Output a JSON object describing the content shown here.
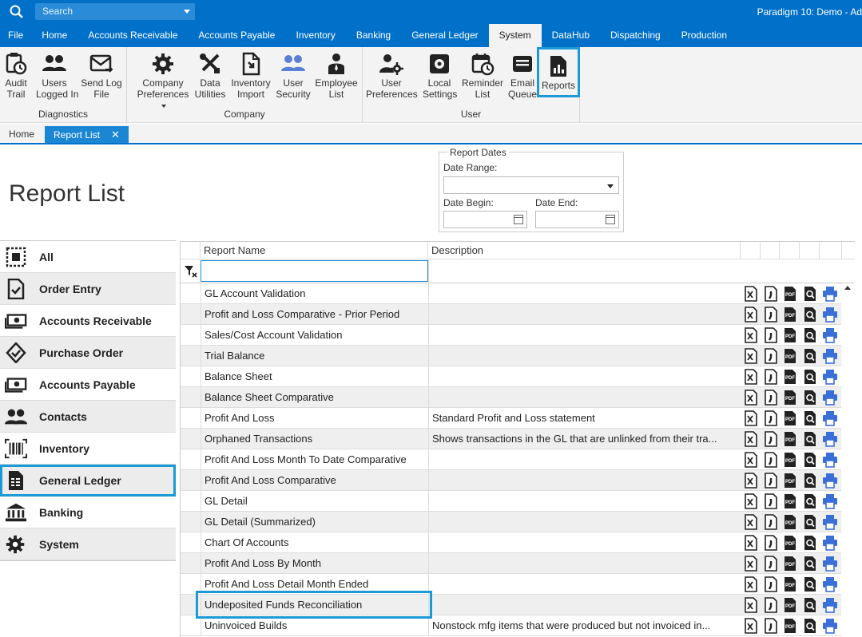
{
  "search": {
    "placeholder": "Search"
  },
  "app_title": "Paradigm 10: Demo - Ad",
  "menu": [
    "File",
    "Home",
    "Accounts Receivable",
    "Accounts Payable",
    "Inventory",
    "Banking",
    "General Ledger",
    "System",
    "DataHub",
    "Dispatching",
    "Production"
  ],
  "menu_active": "System",
  "ribbon": {
    "diagnostics": {
      "label": "Diagnostics",
      "buttons": [
        "Audit\nTrail",
        "Users\nLogged In",
        "Send Log\nFile"
      ]
    },
    "company": {
      "label": "Company",
      "buttons": [
        "Company\nPreferences",
        "Data\nUtilities",
        "Inventory\nImport",
        "User\nSecurity",
        "Employee\nList"
      ]
    },
    "user": {
      "label": "User",
      "buttons": [
        "User\nPreferences",
        "Local\nSettings",
        "Reminder\nList",
        "Email\nQueue",
        "Reports"
      ]
    }
  },
  "tabs": [
    "Home",
    "Report List"
  ],
  "tab_close": "✕",
  "page_title": "Report List",
  "report_dates": {
    "legend": "Report Dates",
    "date_range": "Date Range:",
    "date_begin": "Date Begin:",
    "date_end": "Date End:"
  },
  "sidebar": [
    "All",
    "Order Entry",
    "Accounts Receivable",
    "Purchase Order",
    "Accounts Payable",
    "Contacts",
    "Inventory",
    "General Ledger",
    "Banking",
    "System"
  ],
  "sidebar_selected": "General Ledger",
  "grid": {
    "columns": [
      "Report Name",
      "Description"
    ],
    "rows": [
      {
        "name": "GL Account Validation",
        "desc": ""
      },
      {
        "name": "Profit and Loss Comparative - Prior Period",
        "desc": ""
      },
      {
        "name": "Sales/Cost Account Validation",
        "desc": ""
      },
      {
        "name": "Trial Balance",
        "desc": ""
      },
      {
        "name": "Balance Sheet",
        "desc": ""
      },
      {
        "name": "Balance Sheet Comparative",
        "desc": ""
      },
      {
        "name": "Profit And Loss",
        "desc": "Standard Profit and Loss statement"
      },
      {
        "name": "Orphaned Transactions",
        "desc": "Shows transactions in the GL that are unlinked from their tra..."
      },
      {
        "name": "Profit And Loss Month To Date Comparative",
        "desc": ""
      },
      {
        "name": "Profit And Loss Comparative",
        "desc": ""
      },
      {
        "name": "GL Detail",
        "desc": ""
      },
      {
        "name": "GL Detail (Summarized)",
        "desc": ""
      },
      {
        "name": "Chart Of Accounts",
        "desc": ""
      },
      {
        "name": "Profit And Loss By Month",
        "desc": ""
      },
      {
        "name": "Profit And Loss Detail Month Ended",
        "desc": ""
      },
      {
        "name": "Undeposited Funds Reconciliation",
        "desc": ""
      },
      {
        "name": "Uninvoiced Builds",
        "desc": "Nonstock mfg items that were produced but not invoiced in..."
      }
    ],
    "row_icons": [
      "excel-icon",
      "word-icon",
      "pdf-icon",
      "preview-icon",
      "print-icon"
    ]
  },
  "colors": {
    "accent": "#0070c9",
    "highlight": "#1a9ad6",
    "print_blue": "#3a6fd8"
  }
}
